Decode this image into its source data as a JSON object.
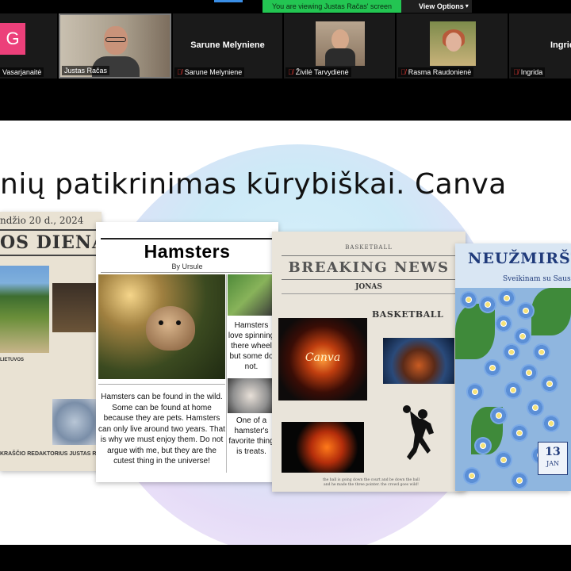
{
  "banner": {
    "viewing_text": "You are viewing Justas Račas' screen",
    "view_options_label": "View Options"
  },
  "participants": [
    {
      "name": "Vasarjanaitė",
      "initial": "G",
      "muted": false
    },
    {
      "name": "Justas Račas",
      "muted": false
    },
    {
      "name": "Sarune Melyniene",
      "center_name": "Sarune Melyniene",
      "muted": true
    },
    {
      "name": "Živilė Tarvydienė",
      "muted": true
    },
    {
      "name": "Rasma Raudonienė",
      "muted": true
    },
    {
      "name": "Ingrida",
      "center_name": "Ingrid",
      "muted": true
    }
  ],
  "slide": {
    "title": "nių patikrinimas kūrybiškai. Canva",
    "card1": {
      "date": "ndžio 20 d., 2024",
      "masthead": "OS DIENA",
      "section": "LIETUVOS",
      "footer": "KRAŠČIO REDAKTORIUS JUSTAS R"
    },
    "card2": {
      "title": "Hamsters",
      "byline": "By Ursule",
      "main_text": "Hamsters can be found in the wild. Some can be found at home because they are pets. Hamsters can only live around two years. That is  why we must enjoy them. Do not argue with me, but they are the cutest thing in the universe!",
      "side_text_1": "Hamsters love spinning there wheel but some do not.",
      "side_text_2": "One of a hamster's favorite thing is treats."
    },
    "card3": {
      "kicker": "BASKETBALL",
      "headline": "BREAKING NEWS",
      "author": "JONAS",
      "section": "BASKETBALL",
      "image_word": "Canva",
      "caption": "the ball is going down the court and be down the ball and he made the three pointer. the crowd goes wild!"
    },
    "card4": {
      "head": "NEUŽMIRŠT",
      "sub": "Sveikinam su Sausi",
      "day": "13",
      "month": "JAN"
    }
  },
  "colors": {
    "banner_green": "#23c552",
    "mute_red": "#e53935",
    "avatar_pink": "#ec407a"
  }
}
